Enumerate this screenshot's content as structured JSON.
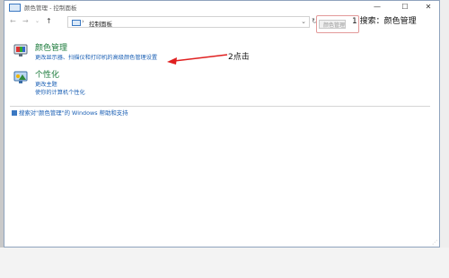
{
  "window": {
    "title": "颜色管理 - 控制面板",
    "minimize": "—",
    "maximize": "☐",
    "close": "✕"
  },
  "nav": {
    "back": "←",
    "forward": "→",
    "recent": "⌄",
    "up": "↑",
    "address": "控制面板",
    "address_sep": "›",
    "address_dropdown": "⌄",
    "refresh": "↻"
  },
  "search": {
    "value": "颜色管理"
  },
  "annotations": {
    "step1": "1 搜索：颜色管理",
    "step2": "2点击",
    "color": "#e02020"
  },
  "categories": [
    {
      "title": "颜色管理",
      "links": [
        "更改显示器、扫描仪和打印机的高级颜色管理设置"
      ]
    },
    {
      "title": "个性化",
      "links": [
        "更改主题",
        "使你的计算机个性化"
      ]
    }
  ],
  "help": {
    "text": "搜索对\"颜色管理\"的 Windows 帮助和支持"
  },
  "colors": {
    "link": "#1a5fb4",
    "category_title": "#1a7a3a"
  }
}
